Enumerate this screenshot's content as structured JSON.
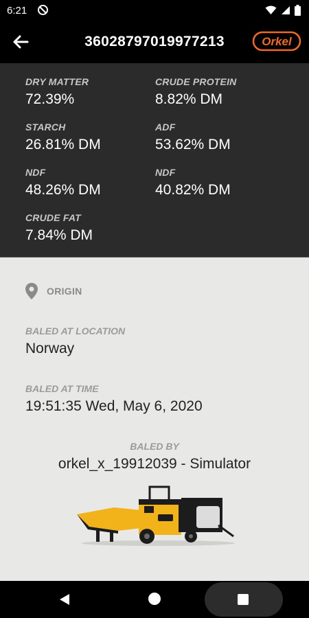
{
  "status_bar": {
    "time": "6:21",
    "icons": [
      "no-disturb-icon",
      "wifi-icon",
      "signal-icon",
      "battery-icon"
    ]
  },
  "app_bar": {
    "title": "36028797019977213",
    "back_icon": "arrow-left-icon",
    "logo_text": "Orkel",
    "logo_color": "#f26a21"
  },
  "nutrients": [
    {
      "label": "DRY MATTER",
      "value": "72.39%"
    },
    {
      "label": "CRUDE PROTEIN",
      "value": "8.82% DM"
    },
    {
      "label": "STARCH",
      "value": "26.81% DM"
    },
    {
      "label": "ADF",
      "value": "53.62% DM"
    },
    {
      "label": "NDF",
      "value": "48.26% DM"
    },
    {
      "label": "NDF",
      "value": "40.82% DM"
    },
    {
      "label": "CRUDE FAT",
      "value": "7.84% DM"
    }
  ],
  "origin": {
    "heading": "ORIGIN",
    "icon": "location-pin-icon",
    "location_label": "BALED AT LOCATION",
    "location_value": "Norway",
    "time_label": "BALED AT TIME",
    "time_value": "19:51:35 Wed, May 6, 2020",
    "baled_by_label": "BALED BY",
    "baled_by_value": "orkel_x_19912039 - Simulator",
    "machine_image": "baler-machine",
    "machine_colors": {
      "body": "#f2b21a",
      "frame": "#1c1c1c"
    }
  },
  "nav_bar": {
    "icons": [
      "nav-back-icon",
      "nav-home-icon",
      "nav-recents-icon"
    ]
  }
}
